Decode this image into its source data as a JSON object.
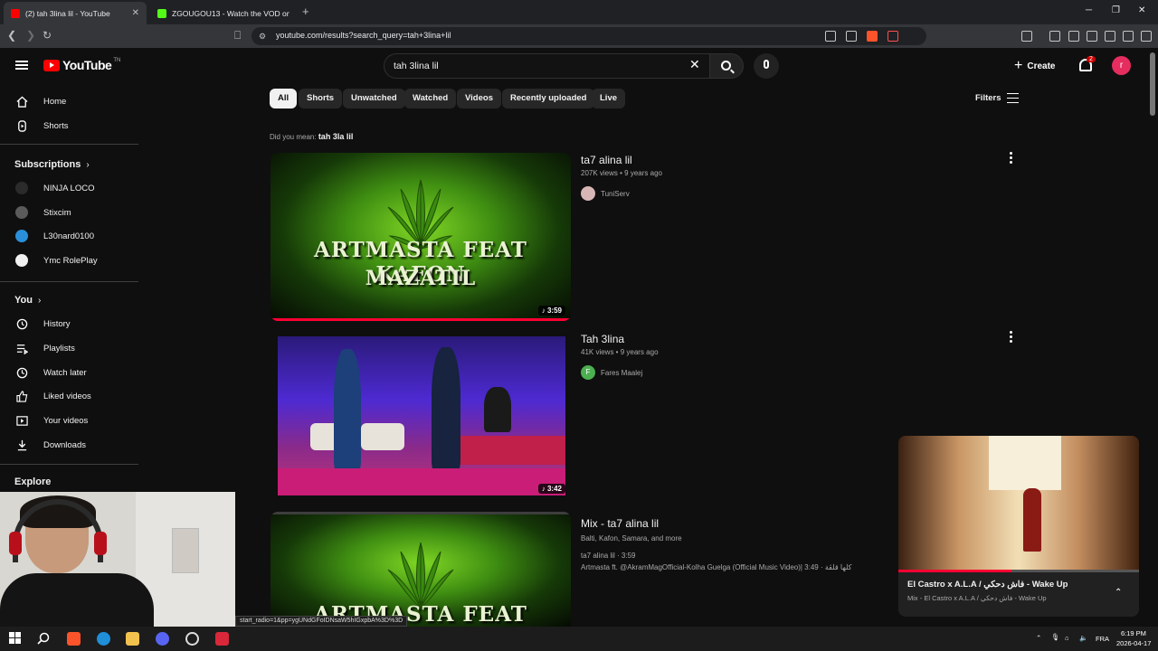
{
  "browser": {
    "tabs": [
      {
        "title": "(2) tah 3lina lil - YouTube",
        "active": true
      },
      {
        "title": "ZGOUGOU13 - Watch the VOD on K",
        "active": false
      }
    ],
    "url": "youtube.com/results?search_query=tah+3lina+lil"
  },
  "header": {
    "logo": "YouTube",
    "logo_sup": "TN",
    "search_value": "tah 3lina lil",
    "create_label": "Create",
    "notif_count": "2",
    "avatar_letter": "r"
  },
  "sidebar": {
    "main": [
      {
        "label": "Home",
        "icon": "home-icon"
      },
      {
        "label": "Shorts",
        "icon": "shorts-icon"
      }
    ],
    "subscriptions_title": "Subscriptions",
    "subscriptions": [
      {
        "label": "NINJA LOCO",
        "color": "#2b2b2b"
      },
      {
        "label": "Stixcim",
        "color": "#5b5b5b"
      },
      {
        "label": "L30nard0100",
        "color": "#2a8fd8"
      },
      {
        "label": "Ymc RolePlay",
        "color": "#f1f1f1"
      }
    ],
    "you_title": "You",
    "you": [
      {
        "label": "History",
        "icon": "history-icon"
      },
      {
        "label": "Playlists",
        "icon": "playlists-icon"
      },
      {
        "label": "Watch later",
        "icon": "watch-later-icon"
      },
      {
        "label": "Liked videos",
        "icon": "like-icon"
      },
      {
        "label": "Your videos",
        "icon": "your-videos-icon"
      },
      {
        "label": "Downloads",
        "icon": "download-icon"
      }
    ],
    "explore_title": "Explore"
  },
  "chips": [
    "All",
    "Shorts",
    "Unwatched",
    "Watched",
    "Videos",
    "Recently uploaded",
    "Live"
  ],
  "filters_label": "Filters",
  "did_you_mean": {
    "prefix": "Did you mean: ",
    "suggestion": "tah 3la lil"
  },
  "results": [
    {
      "title": "ta7 alina lil",
      "meta": "207K views • 9 years ago",
      "channel": "TuniServ",
      "duration": "3:59",
      "thumb_text_1": "ARTMASTA FEAT KAFON",
      "thumb_text_2": "MAZATIL",
      "watched_fraction": 1.0
    },
    {
      "title": "Tah 3lina",
      "meta": "41K views • 9 years ago",
      "channel": "Fares Maalej",
      "channel_initial": "F",
      "duration": "3:42"
    },
    {
      "title": "Mix - ta7 alina lil",
      "channel": "Balti, Kafon, Samara, and more",
      "line1": "ta7 alina lil · 3:59",
      "line2": "Artmasta ft. @AkramMagOfficial-Kolha Guelga (Official Music Video)| 3:49 · كلها قلڤة",
      "thumb_text_1": "ARTMASTA FEAT KAFON"
    }
  ],
  "miniplayer": {
    "title": "El Castro x A.L.A / فاش دحكي - Wake Up",
    "subtitle": "Mix - El Castro x A.L.A / فاش دحكي - Wake Up",
    "progress": 0.47
  },
  "status_url": "start_radio=1&pp=ygUNdGFoIDNsaW5hIGxpbA%3D%3D",
  "taskbar": {
    "lang": "FRA",
    "time": "6:19 PM",
    "date": "2026-04-17"
  }
}
